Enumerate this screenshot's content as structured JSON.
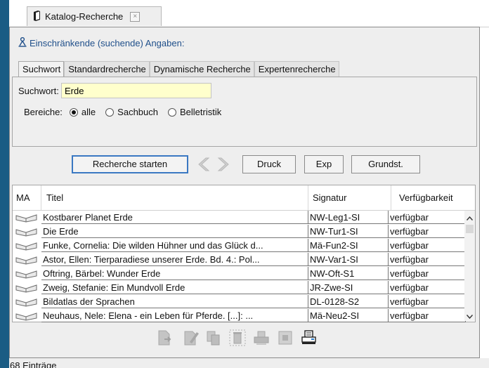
{
  "window": {
    "doc_tab_title": "Katalog-Recherche",
    "close_glyph": "×"
  },
  "panel": {
    "header": "Einschränkende (suchende) Angaben:",
    "tabs": [
      "Suchwort",
      "Standardrecherche",
      "Dynamische Recherche",
      "Expertenrecherche"
    ],
    "active_tab": "Suchwort"
  },
  "search": {
    "label": "Suchwort:",
    "value": "Erde",
    "bereiche_label": "Bereiche:",
    "options": [
      "alle",
      "Sachbuch",
      "Belletristik"
    ],
    "selected": "alle"
  },
  "buttons": {
    "start": "Recherche starten",
    "print": "Druck",
    "export": "Exp",
    "settings": "Grundst."
  },
  "table": {
    "headers": [
      "MA",
      "Titel",
      "Signatur",
      "Verfügbarkeit"
    ],
    "rows": [
      {
        "titel": "Kostbarer Planet Erde",
        "signatur": "NW-Leg1-SI",
        "status": "verfügbar"
      },
      {
        "titel": "Die Erde",
        "signatur": "NW-Tur1-SI",
        "status": "verfügbar"
      },
      {
        "titel": "Funke, Cornelia: Die wilden Hühner und das Glück d...",
        "signatur": "Mä-Fun2-SI",
        "status": "verfügbar"
      },
      {
        "titel": "Astor, Ellen: Tierparadiese unserer Erde. Bd. 4.: Pol...",
        "signatur": "NW-Var1-SI",
        "status": "verfügbar"
      },
      {
        "titel": "Oftring, Bärbel: Wunder Erde",
        "signatur": "NW-Oft-S1",
        "status": "verfügbar"
      },
      {
        "titel": "Zweig, Stefanie: Ein Mundvoll Erde",
        "signatur": "JR-Zwe-SI",
        "status": "verfügbar"
      },
      {
        "titel": "Bildatlas der Sprachen",
        "signatur": "DL-0128-S2",
        "status": "verfügbar"
      },
      {
        "titel": "Neuhaus, Nele: Elena - ein Leben für Pferde. [...]: ...",
        "signatur": "Mä-Neu2-SI",
        "status": "verfügbar"
      }
    ]
  },
  "status": {
    "text": "68 Einträge"
  },
  "icons": {
    "doc_tab": "book-icon",
    "header": "person-filter-icon",
    "row": "open-book-icon",
    "toolbar": [
      "new-doc-icon",
      "edit-doc-icon",
      "copy-doc-icon",
      "delete-icon",
      "print-icon",
      "frame-icon",
      "print-preview-icon"
    ]
  },
  "colors": {
    "accent_blue": "#3a78c2",
    "header_text": "#1f4f8a",
    "input_bg": "#ffffcc",
    "left_bar": "#1a5c84"
  }
}
